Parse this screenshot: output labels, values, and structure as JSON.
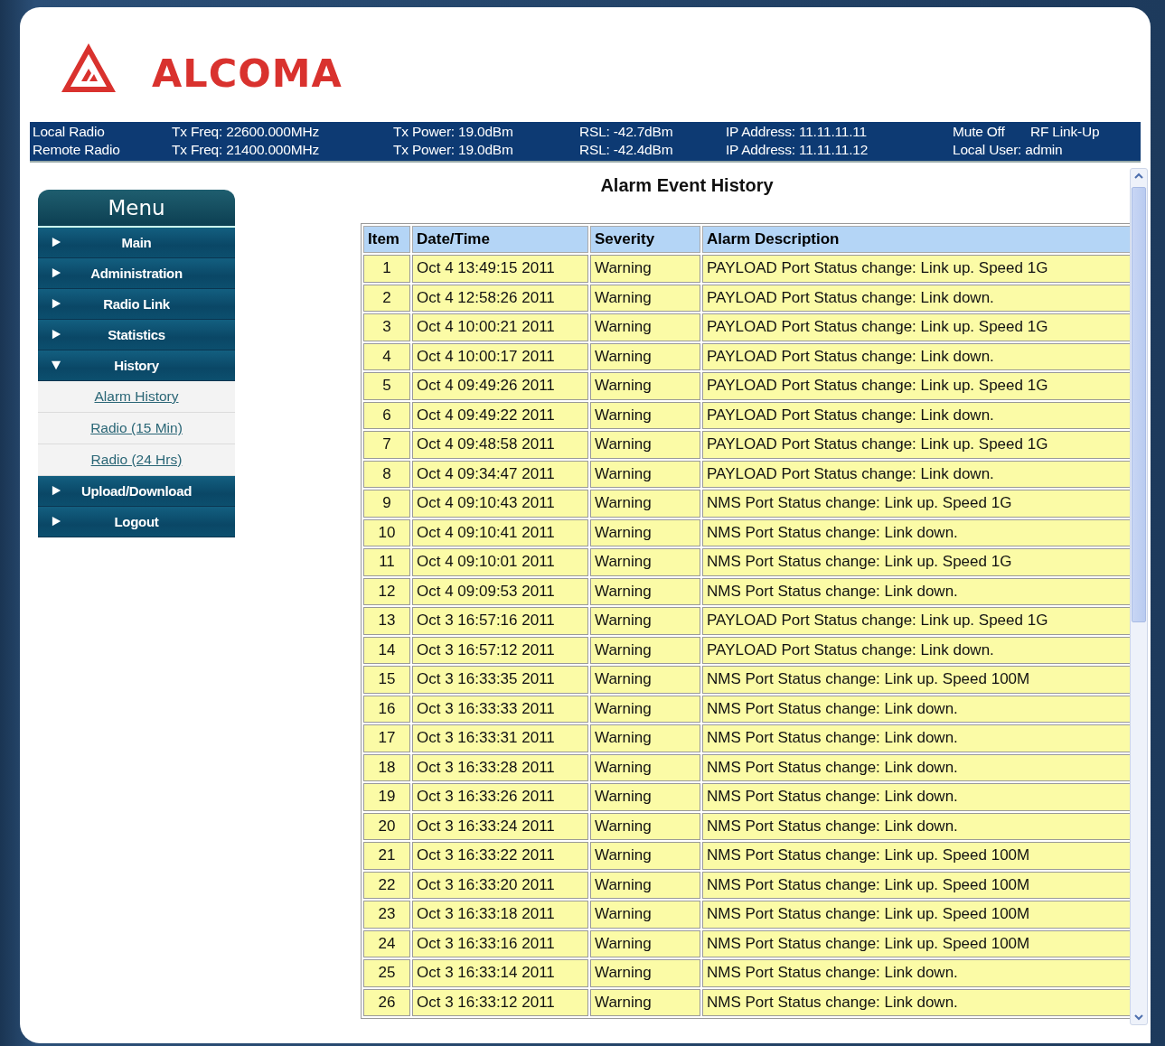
{
  "logo": "ALCOMA",
  "status_bar": {
    "rows": [
      [
        "Local Radio",
        "Tx Freq: 22600.000MHz",
        "Tx Power: 19.0dBm",
        "RSL: -42.7dBm",
        "IP Address: 11.11.11.11",
        "Mute Off",
        "RF Link-Up"
      ],
      [
        "Remote Radio",
        "Tx Freq: 21400.000MHz",
        "Tx Power: 19.0dBm",
        "RSL: -42.4dBm",
        "IP Address: 11.11.11.12",
        "Local User: admin"
      ]
    ]
  },
  "menu": {
    "title": "Menu",
    "items": [
      {
        "label": "Main",
        "expanded": false
      },
      {
        "label": "Administration",
        "expanded": false
      },
      {
        "label": "Radio Link",
        "expanded": false
      },
      {
        "label": "Statistics",
        "expanded": false
      },
      {
        "label": "History",
        "expanded": true,
        "children": [
          "Alarm History",
          "Radio (15 Min)",
          "Radio (24 Hrs)"
        ]
      },
      {
        "label": "Upload/Download",
        "expanded": false
      },
      {
        "label": "Logout",
        "expanded": false
      }
    ]
  },
  "content": {
    "title": "Alarm Event History",
    "table": {
      "columns": [
        "Item",
        "Date/Time",
        "Severity",
        "Alarm Description"
      ],
      "rows": [
        [
          "1",
          "Oct 4 13:49:15 2011",
          "Warning",
          "PAYLOAD Port Status change: Link up. Speed 1G"
        ],
        [
          "2",
          "Oct 4 12:58:26 2011",
          "Warning",
          "PAYLOAD Port Status change: Link down."
        ],
        [
          "3",
          "Oct 4 10:00:21 2011",
          "Warning",
          "PAYLOAD Port Status change: Link up. Speed 1G"
        ],
        [
          "4",
          "Oct 4 10:00:17 2011",
          "Warning",
          "PAYLOAD Port Status change: Link down."
        ],
        [
          "5",
          "Oct 4 09:49:26 2011",
          "Warning",
          "PAYLOAD Port Status change: Link up. Speed 1G"
        ],
        [
          "6",
          "Oct 4 09:49:22 2011",
          "Warning",
          "PAYLOAD Port Status change: Link down."
        ],
        [
          "7",
          "Oct 4 09:48:58 2011",
          "Warning",
          "PAYLOAD Port Status change: Link up. Speed 1G"
        ],
        [
          "8",
          "Oct 4 09:34:47 2011",
          "Warning",
          "PAYLOAD Port Status change: Link down."
        ],
        [
          "9",
          "Oct 4 09:10:43 2011",
          "Warning",
          "NMS Port Status change: Link up. Speed 1G"
        ],
        [
          "10",
          "Oct 4 09:10:41 2011",
          "Warning",
          "NMS Port Status change: Link down."
        ],
        [
          "11",
          "Oct 4 09:10:01 2011",
          "Warning",
          "NMS Port Status change: Link up. Speed 1G"
        ],
        [
          "12",
          "Oct 4 09:09:53 2011",
          "Warning",
          "NMS Port Status change: Link down."
        ],
        [
          "13",
          "Oct 3 16:57:16 2011",
          "Warning",
          "PAYLOAD Port Status change: Link up. Speed 1G"
        ],
        [
          "14",
          "Oct 3 16:57:12 2011",
          "Warning",
          "PAYLOAD Port Status change: Link down."
        ],
        [
          "15",
          "Oct 3 16:33:35 2011",
          "Warning",
          "NMS Port Status change: Link up. Speed 100M"
        ],
        [
          "16",
          "Oct 3 16:33:33 2011",
          "Warning",
          "NMS Port Status change: Link down."
        ],
        [
          "17",
          "Oct 3 16:33:31 2011",
          "Warning",
          "NMS Port Status change: Link down."
        ],
        [
          "18",
          "Oct 3 16:33:28 2011",
          "Warning",
          "NMS Port Status change: Link down."
        ],
        [
          "19",
          "Oct 3 16:33:26 2011",
          "Warning",
          "NMS Port Status change: Link down."
        ],
        [
          "20",
          "Oct 3 16:33:24 2011",
          "Warning",
          "NMS Port Status change: Link down."
        ],
        [
          "21",
          "Oct 3 16:33:22 2011",
          "Warning",
          "NMS Port Status change: Link up. Speed 100M"
        ],
        [
          "22",
          "Oct 3 16:33:20 2011",
          "Warning",
          "NMS Port Status change: Link up. Speed 100M"
        ],
        [
          "23",
          "Oct 3 16:33:18 2011",
          "Warning",
          "NMS Port Status change: Link up. Speed 100M"
        ],
        [
          "24",
          "Oct 3 16:33:16 2011",
          "Warning",
          "NMS Port Status change: Link up. Speed 100M"
        ],
        [
          "25",
          "Oct 3 16:33:14 2011",
          "Warning",
          "NMS Port Status change: Link down."
        ],
        [
          "26",
          "Oct 3 16:33:12 2011",
          "Warning",
          "NMS Port Status change: Link down."
        ]
      ]
    }
  }
}
